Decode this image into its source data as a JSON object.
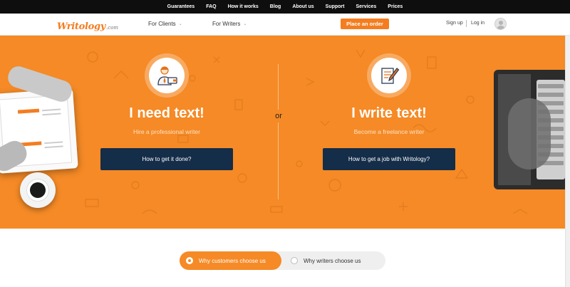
{
  "topnav": {
    "items": [
      "Guarantees",
      "FAQ",
      "How it works",
      "Blog",
      "About us",
      "Support",
      "Services",
      "Prices"
    ]
  },
  "header": {
    "logo": {
      "main": "Writology",
      "suffix": ".com"
    },
    "nav_clients": "For Clients",
    "nav_writers": "For Writers",
    "order_button": "Place an order",
    "signup": "Sign up",
    "login": "Log in"
  },
  "hero": {
    "left": {
      "title": "I need text!",
      "subtitle": "Hire a professional writer",
      "button": "How to get it done?",
      "icon": "businessman-wallet-icon"
    },
    "or": "or",
    "right": {
      "title": "I write text!",
      "subtitle": "Become a freelance writer",
      "button": "How to get a job with Writology?",
      "icon": "pen-document-icon"
    },
    "colors": {
      "orange": "#f58a26",
      "navy": "#142d48"
    }
  },
  "toggle": {
    "options": [
      "Why customers choose us",
      "Why writers choose us"
    ],
    "selected": "Why customers choose us"
  }
}
